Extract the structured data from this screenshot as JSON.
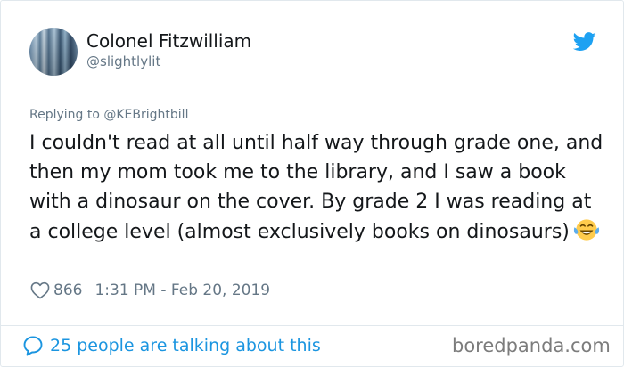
{
  "author": {
    "name": "Colonel Fitzwilliam",
    "handle": "@slightlylit"
  },
  "icons": {
    "platform": "twitter-bird-icon",
    "like": "heart-outline-icon",
    "conversation": "speech-bubble-icon",
    "emoji": "face-with-tears-of-joy-emoji"
  },
  "reply_to": "Replying to @KEBrightbill",
  "tweet": {
    "text": "I couldn't read at all until half way through grade one, and then my mom took me to the library, and I saw a book with a dinosaur on the cover. By grade 2 I was reading at a college level (almost exclusively books on dinosaurs)"
  },
  "stats": {
    "likes": "866",
    "timestamp": "1:31 PM - Feb 20, 2019"
  },
  "footer": {
    "conversation_text": "25 people are talking about this",
    "watermark": "boredpanda.com"
  },
  "colors": {
    "twitter_blue": "#1da1f2",
    "link_blue": "#1b95e0",
    "secondary_text": "#657786",
    "primary_text": "#14171a",
    "border": "#e1e8ed"
  }
}
